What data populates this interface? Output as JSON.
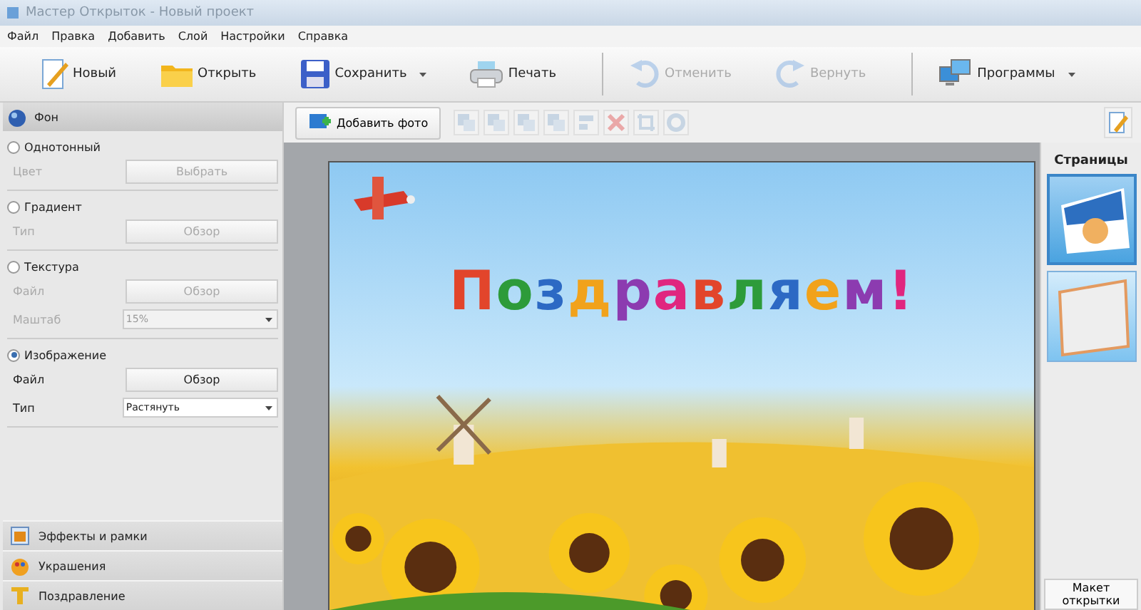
{
  "window": {
    "title": "Мастер Открыток - Новый проект"
  },
  "menu": [
    "Файл",
    "Правка",
    "Добавить",
    "Слой",
    "Настройки",
    "Справка"
  ],
  "toolbar": [
    {
      "kind": "new",
      "label": "Новый",
      "disabled": false,
      "dropdown": false
    },
    {
      "kind": "open",
      "label": "Открыть",
      "disabled": false,
      "dropdown": false
    },
    {
      "kind": "save",
      "label": "Сохранить",
      "disabled": false,
      "dropdown": true
    },
    {
      "kind": "print",
      "label": "Печать",
      "disabled": false,
      "dropdown": false
    },
    {
      "kind": "undo",
      "label": "Отменить",
      "disabled": true,
      "dropdown": false
    },
    {
      "kind": "redo",
      "label": "Вернуть",
      "disabled": true,
      "dropdown": false
    },
    {
      "kind": "programs",
      "label": "Программы",
      "disabled": false,
      "dropdown": true
    }
  ],
  "left_panel": {
    "header": "Фон",
    "sections": [
      {
        "label": "Однотонный",
        "selected": false,
        "fields": [
          {
            "label": "Цвет",
            "kind": "button",
            "value": "Выбрать"
          }
        ]
      },
      {
        "label": "Градиент",
        "selected": false,
        "fields": [
          {
            "label": "Тип",
            "kind": "button",
            "value": "Обзор"
          }
        ]
      },
      {
        "label": "Текстура",
        "selected": false,
        "fields": [
          {
            "label": "Файл",
            "kind": "button",
            "value": "Обзор"
          },
          {
            "label": "Маштаб",
            "kind": "select",
            "value": "15%"
          }
        ]
      },
      {
        "label": "Изображение",
        "selected": true,
        "fields": [
          {
            "label": "Файл",
            "kind": "button",
            "value": "Обзор"
          },
          {
            "label": "Тип",
            "kind": "select",
            "value": "Растянуть"
          }
        ]
      }
    ],
    "accordion": [
      {
        "kind": "effects",
        "label": "Эффекты и рамки"
      },
      {
        "kind": "decor",
        "label": "Украшения"
      },
      {
        "kind": "text",
        "label": "Поздравление"
      }
    ]
  },
  "canvas_toolbar": {
    "add_photo": "Добавить фото",
    "tools": [
      {
        "kind": "layer",
        "disabled": true
      },
      {
        "kind": "layer",
        "disabled": true
      },
      {
        "kind": "layer",
        "disabled": true
      },
      {
        "kind": "layer",
        "disabled": true
      },
      {
        "kind": "align",
        "disabled": true
      },
      {
        "kind": "delete",
        "disabled": true
      },
      {
        "kind": "crop",
        "disabled": true
      },
      {
        "kind": "settings",
        "disabled": true
      }
    ]
  },
  "card": {
    "greeting": "Поздравляем!"
  },
  "pages": {
    "title": "Страницы",
    "thumbnails": [
      {
        "kind": "front",
        "selected": true
      },
      {
        "kind": "text",
        "selected": false
      }
    ],
    "layout_button": "Макет открытки"
  }
}
